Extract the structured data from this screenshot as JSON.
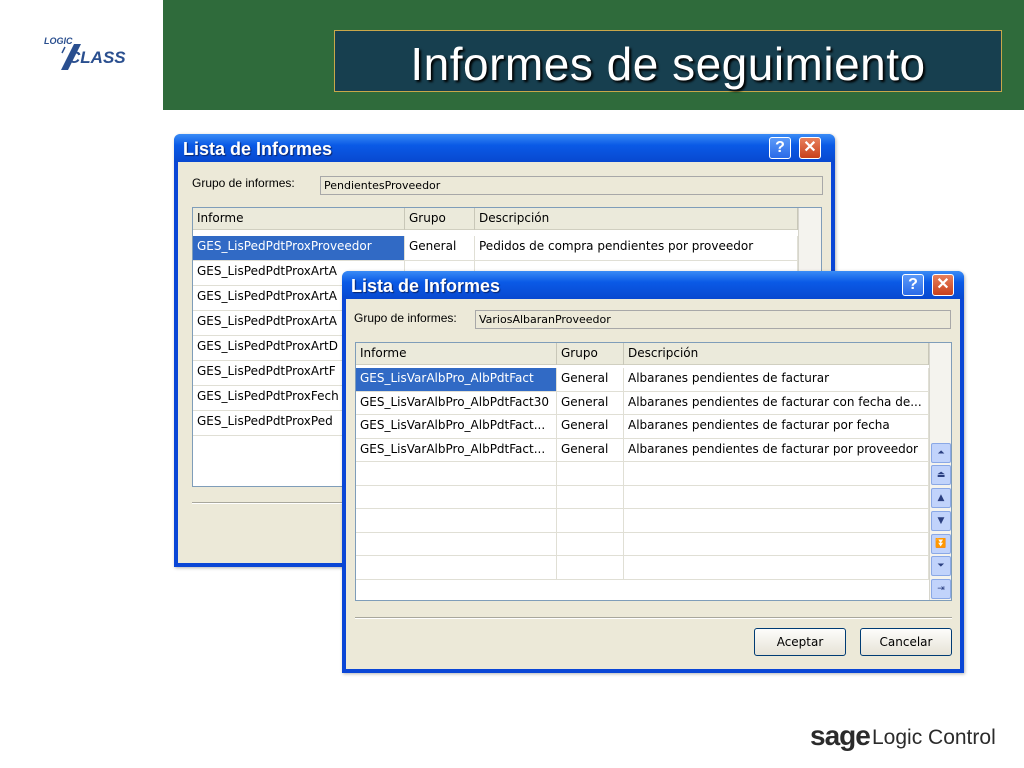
{
  "slide": {
    "title": "Informes de seguimiento",
    "logo": {
      "small_text": "LOGIC",
      "main_text": "CLASS"
    },
    "footer_logo": {
      "brand": "sage",
      "product": "Logic Control"
    },
    "colors": {
      "header_band": "#2f6b3b",
      "title_box": "#173f4f",
      "title_border": "#c8a74a",
      "selection": "#316ac5"
    }
  },
  "window_back": {
    "title": "Lista de Informes",
    "help_icon": "help-icon",
    "close_icon": "close-icon",
    "group_label": "Grupo de informes:",
    "group_value": "PendientesProveedor",
    "columns": [
      "Informe",
      "Grupo",
      "Descripción"
    ],
    "rows": [
      {
        "informe": "GES_LisPedPdtProxProveedor",
        "grupo": "General",
        "descripcion": "Pedidos de compra pendientes por proveedor",
        "selected": true
      },
      {
        "informe": "GES_LisPedPdtProxArtA",
        "grupo": "",
        "descripcion": "",
        "selected": false
      },
      {
        "informe": "GES_LisPedPdtProxArtA",
        "grupo": "",
        "descripcion": "",
        "selected": false
      },
      {
        "informe": "GES_LisPedPdtProxArtA",
        "grupo": "",
        "descripcion": "",
        "selected": false
      },
      {
        "informe": "GES_LisPedPdtProxArtD",
        "grupo": "",
        "descripcion": "",
        "selected": false
      },
      {
        "informe": "GES_LisPedPdtProxArtF",
        "grupo": "",
        "descripcion": "",
        "selected": false
      },
      {
        "informe": "GES_LisPedPdtProxFech",
        "grupo": "",
        "descripcion": "",
        "selected": false
      },
      {
        "informe": "GES_LisPedPdtProxPed",
        "grupo": "",
        "descripcion": "",
        "selected": false
      }
    ]
  },
  "window_front": {
    "title": "Lista de Informes",
    "help_icon": "help-icon",
    "close_icon": "close-icon",
    "group_label": "Grupo de informes:",
    "group_value": "VariosAlbaranProveedor",
    "columns": [
      "Informe",
      "Grupo",
      "Descripción"
    ],
    "rows": [
      {
        "informe": "GES_LisVarAlbPro_AlbPdtFact",
        "grupo": "General",
        "descripcion": "Albaranes pendientes de facturar",
        "selected": true
      },
      {
        "informe": "GES_LisVarAlbPro_AlbPdtFact30",
        "grupo": "General",
        "descripcion": "Albaranes pendientes de facturar con fecha de...",
        "selected": false
      },
      {
        "informe": "GES_LisVarAlbPro_AlbPdtFact...",
        "grupo": "General",
        "descripcion": "Albaranes pendientes de facturar por fecha",
        "selected": false
      },
      {
        "informe": "GES_LisVarAlbPro_AlbPdtFact...",
        "grupo": "General",
        "descripcion": "Albaranes pendientes de facturar por proveedor",
        "selected": false
      }
    ],
    "empty_rows": 5,
    "scroll_buttons": [
      "scroll-top-icon",
      "scroll-page-up-icon",
      "scroll-up-icon",
      "scroll-down-icon",
      "scroll-page-down-icon",
      "scroll-bottom-icon",
      "export-icon"
    ],
    "accept_label": "Aceptar",
    "cancel_label": "Cancelar"
  }
}
